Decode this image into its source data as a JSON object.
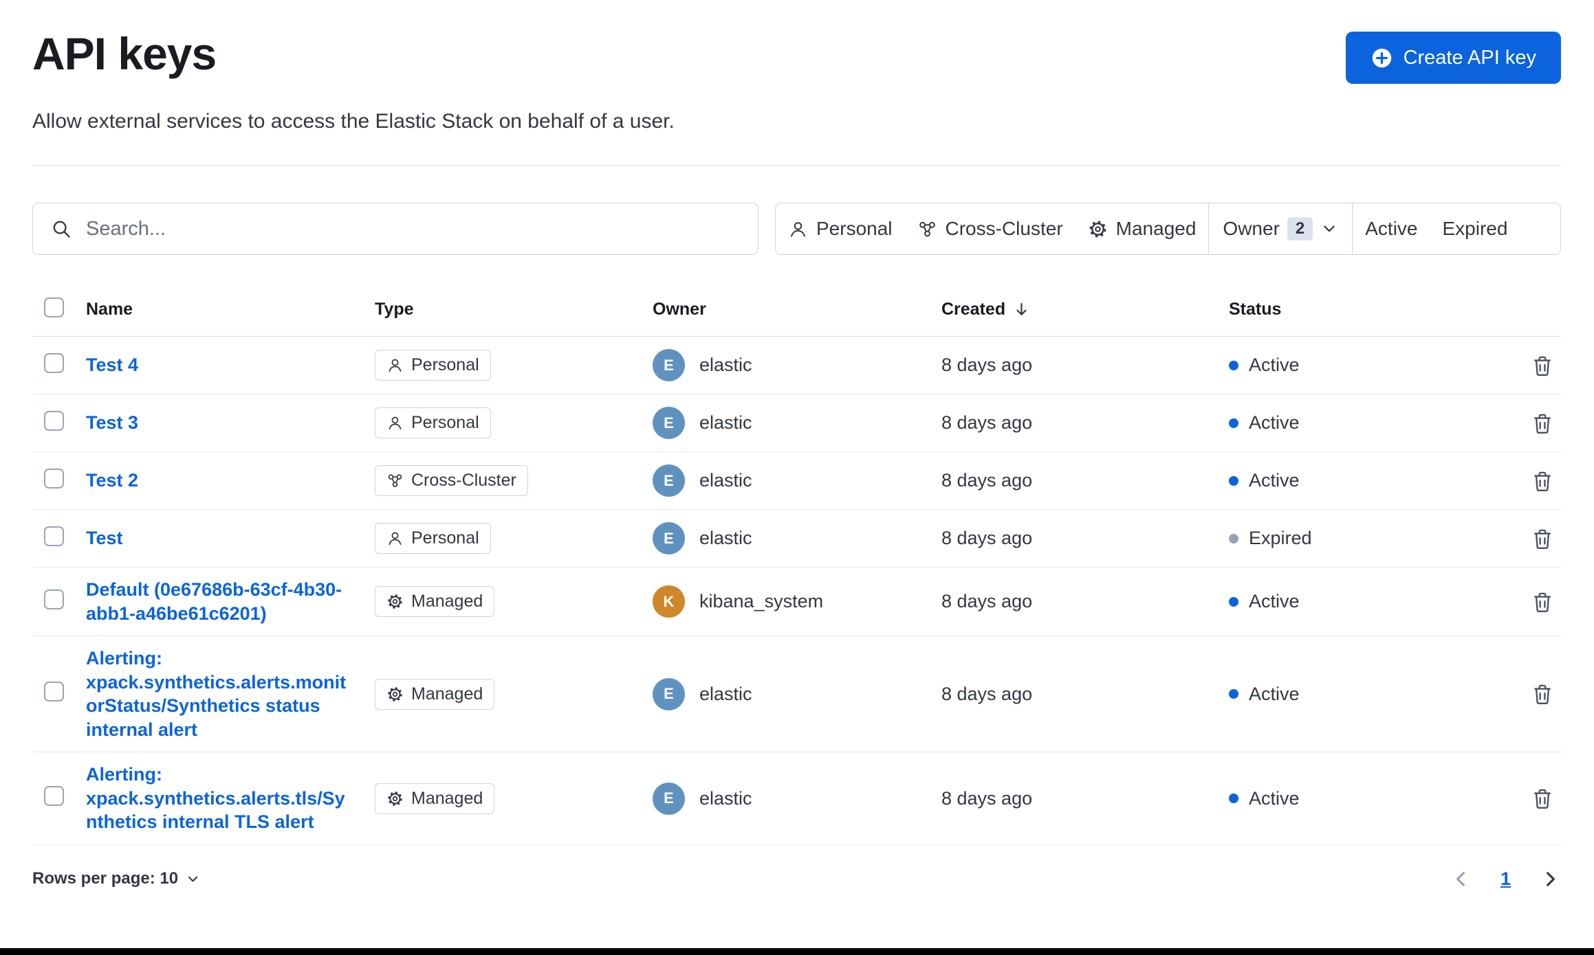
{
  "page": {
    "title": "API keys",
    "subtitle": "Allow external services to access the Elastic Stack on behalf of a user.",
    "create_button": "Create API key"
  },
  "search": {
    "placeholder": "Search...",
    "value": ""
  },
  "filters": {
    "personal": "Personal",
    "cross_cluster": "Cross-Cluster",
    "managed": "Managed",
    "owner": "Owner",
    "owner_count": "2",
    "active": "Active",
    "expired": "Expired"
  },
  "table": {
    "columns": {
      "name": "Name",
      "type": "Type",
      "owner": "Owner",
      "created": "Created",
      "status": "Status"
    },
    "rows": [
      {
        "name": "Test 4",
        "type_label": "Personal",
        "type_kind": "personal",
        "owner": "elastic",
        "owner_initial": "E",
        "avatar_color": "#6092C0",
        "created": "8 days ago",
        "status": "Active",
        "status_kind": "active"
      },
      {
        "name": "Test 3",
        "type_label": "Personal",
        "type_kind": "personal",
        "owner": "elastic",
        "owner_initial": "E",
        "avatar_color": "#6092C0",
        "created": "8 days ago",
        "status": "Active",
        "status_kind": "active"
      },
      {
        "name": "Test 2",
        "type_label": "Cross-Cluster",
        "type_kind": "cross_cluster",
        "owner": "elastic",
        "owner_initial": "E",
        "avatar_color": "#6092C0",
        "created": "8 days ago",
        "status": "Active",
        "status_kind": "active"
      },
      {
        "name": "Test",
        "type_label": "Personal",
        "type_kind": "personal",
        "owner": "elastic",
        "owner_initial": "E",
        "avatar_color": "#6092C0",
        "created": "8 days ago",
        "status": "Expired",
        "status_kind": "expired"
      },
      {
        "name": "Default (0e67686b-63cf-4b30-abb1-a46be61c6201)",
        "type_label": "Managed",
        "type_kind": "managed",
        "owner": "kibana_system",
        "owner_initial": "K",
        "avatar_color": "#D0862B",
        "created": "8 days ago",
        "status": "Active",
        "status_kind": "active"
      },
      {
        "name": "Alerting: xpack.synthetics.alerts.monitorStatus/Synthetics status internal alert",
        "type_label": "Managed",
        "type_kind": "managed",
        "owner": "elastic",
        "owner_initial": "E",
        "avatar_color": "#6092C0",
        "created": "8 days ago",
        "status": "Active",
        "status_kind": "active"
      },
      {
        "name": "Alerting: xpack.synthetics.alerts.tls/Synthetics internal TLS alert",
        "type_label": "Managed",
        "type_kind": "managed",
        "owner": "elastic",
        "owner_initial": "E",
        "avatar_color": "#6092C0",
        "created": "8 days ago",
        "status": "Active",
        "status_kind": "active"
      }
    ]
  },
  "footer": {
    "rows_per_page": "Rows per page: 10",
    "current_page": "1"
  },
  "icons": {
    "create_button": "plus-circle-icon",
    "search": "search-icon",
    "personal": "person-icon",
    "cross_cluster": "cross-cluster-icon",
    "managed": "gear-icon",
    "owner_dropdown": "chevron-down-icon",
    "sort_created": "arrow-down-icon",
    "row_action": "trash-icon",
    "pagination_prev": "chevron-left-icon",
    "pagination_next": "chevron-right-icon"
  },
  "colors": {
    "primary_blue": "#0B64DD",
    "link_blue": "#0B64DD",
    "active_dot": "#0B64DD",
    "expired_dot": "#98A2B3",
    "avatar_elastic": "#6092C0",
    "avatar_kibana_system": "#D0862B"
  }
}
